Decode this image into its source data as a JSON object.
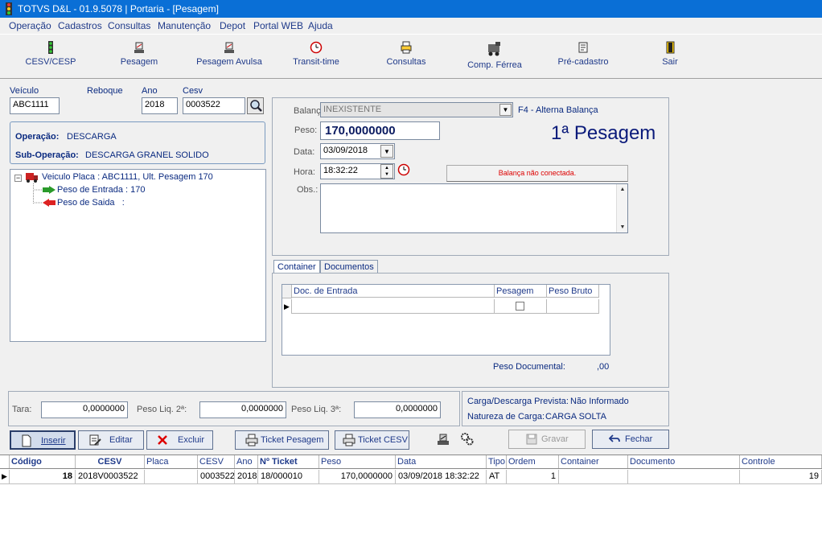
{
  "window": {
    "title": "TOTVS D&L - 01.9.5078 | Portaria - [Pesagem]"
  },
  "menu": [
    "Operação",
    "Cadastros",
    "Consultas",
    "Manutenção",
    "Depot",
    "Portal WEB",
    "Ajuda"
  ],
  "toolbar": {
    "cesv": "CESV/CESP",
    "pesagem": "Pesagem",
    "pesagem_avulsa": "Pesagem Avulsa",
    "transit_time": "Transit-time",
    "consultas": "Consultas",
    "comp_ferrea": "Comp. Férrea",
    "pre_cadastro": "Pré-cadastro",
    "sair": "Sair"
  },
  "vehicle": {
    "veiculo_label": "Veículo",
    "veiculo_value": "ABC1111",
    "reboque_label": "Reboque",
    "ano_label": "Ano",
    "ano_value": "2018",
    "cesv_label": "Cesv",
    "cesv_value": "0003522"
  },
  "operation": {
    "operacao_label": "Operação:",
    "operacao_value": "DESCARGA",
    "suboperacao_label": "Sub-Operação:",
    "suboperacao_value": "DESCARGA GRANEL SOLIDO"
  },
  "tree": {
    "root": "Veiculo Placa : ABC1111, Ult. Pesagem 170",
    "entrada": "Peso de Entrada : 170",
    "saida": "Peso de Saida   :"
  },
  "scale": {
    "balanca_label": "Balança:",
    "balanca_value": "INEXISTENTE",
    "f4_hint": "F4 - Alterna Balança",
    "peso_label": "Peso:",
    "peso_value": "170,0000000",
    "pesagem_title": "1ª Pesagem",
    "data_label": "Data:",
    "data_value": "03/09/2018",
    "hora_label": "Hora:",
    "hora_value": "18:32:22",
    "status": "Balança não conectada.",
    "obs_label": "Obs.:"
  },
  "tabs": [
    "Container",
    "Documentos"
  ],
  "doc_grid": {
    "headers": [
      "Doc. de Entrada",
      "Pesagem",
      "Peso Bruto"
    ],
    "peso_documental_label": "Peso Documental:",
    "peso_documental_value": ",00"
  },
  "totals": {
    "tara_label": "Tara:",
    "tara_value": "0,0000000",
    "liq2_label": "Peso Liq. 2ª:",
    "liq2_value": "0,0000000",
    "liq3_label": "Peso Liq. 3ª:",
    "liq3_value": "0,0000000",
    "prevista_label": "Carga/Descarga Prevista:",
    "prevista_value": "Não Informado",
    "natureza_label": "Natureza de Carga:",
    "natureza_value": "CARGA SOLTA"
  },
  "actions": {
    "inserir": "Inserir",
    "editar": "Editar",
    "excluir": "Excluir",
    "ticket_pesagem": "Ticket Pesagem",
    "ticket_cesv": "Ticket CESV",
    "gravar": "Gravar",
    "fechar": "Fechar"
  },
  "main_grid": {
    "headers": [
      "Código",
      "CESV",
      "Placa",
      "CESV",
      "Ano",
      "Nº Ticket",
      "Peso",
      "Data",
      "Tipo",
      "Ordem",
      "Container",
      "Documento",
      "Controle"
    ],
    "rows": [
      [
        "18",
        "2018V0003522",
        "",
        "0003522",
        "2018",
        "18/000010",
        "170,0000000",
        "03/09/2018 18:32:22",
        "AT",
        "1",
        "",
        "",
        "19"
      ]
    ]
  }
}
